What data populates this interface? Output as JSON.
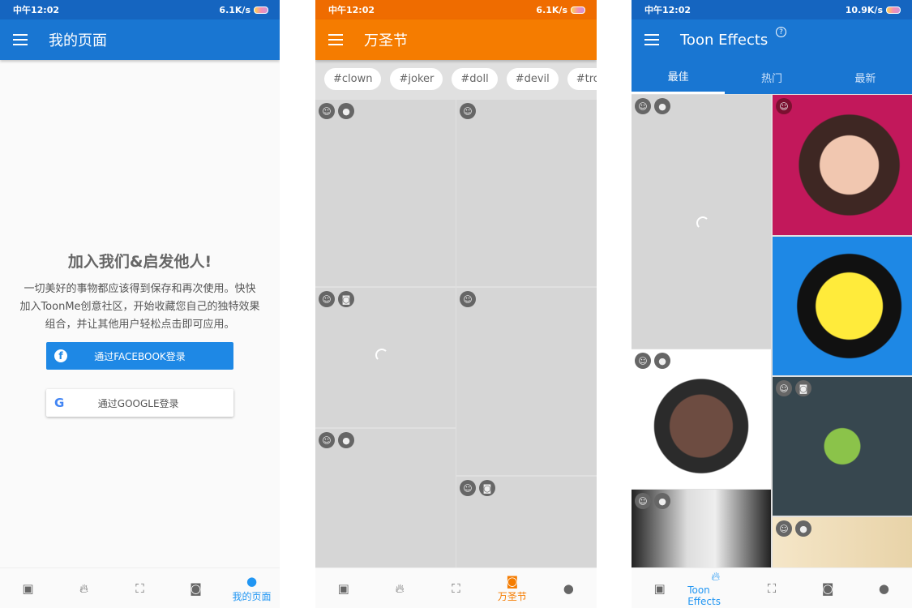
{
  "colors": {
    "blue": "#1976d2",
    "orange": "#f57c00",
    "accent": "#2196f3"
  },
  "screens": [
    {
      "status": {
        "time": "中午12:02",
        "speed": "6.1K/s"
      },
      "title": "我的页面",
      "heading": "加入我们&启发他人!",
      "body": "一切美好的事物都应该得到保存和再次使用。快快加入ToonMe创意社区，开始收藏您自己的独特效果组合，并让其他用户轻松点击即可应用。",
      "facebook_button": "通过FACEBOOK登录",
      "google_button": "通过GOOGLE登录",
      "nav_active_label": "我的页面"
    },
    {
      "status": {
        "time": "中午12:02",
        "speed": "6.1K/s"
      },
      "title": "万圣节",
      "chips": [
        "#clown",
        "#joker",
        "#doll",
        "#devil",
        "#troll"
      ],
      "nav_active_label": "万圣节"
    },
    {
      "status": {
        "time": "中午12:02",
        "speed": "10.9K/s"
      },
      "title": "Toon Effects",
      "tabs": [
        "最佳",
        "热门",
        "最新"
      ],
      "active_tab": 0,
      "nav_active_label": "Toon Effects"
    }
  ]
}
